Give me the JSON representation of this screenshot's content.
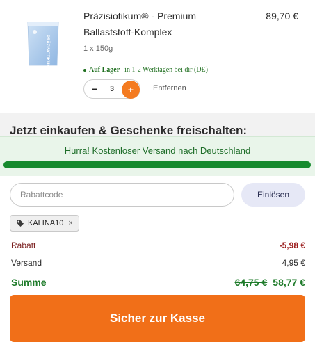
{
  "product": {
    "name": "Präzisiotikum® - Premium Ballaststoff-Komplex",
    "price": "89,70 €",
    "variant": "1 x 150g",
    "stock_status": "Auf Lager",
    "stock_detail": "| in 1-2 Werktagen bei dir (DE)",
    "quantity": "3",
    "minus_label": "−",
    "plus_label": "+",
    "remove_label": "Entfernen",
    "package_label": "PRÄZISIOTIKUM"
  },
  "promo": {
    "heading": "Jetzt einkaufen & Geschenke freischalten:",
    "shipping_message": "Hurra! Kostenloser Versand nach Deutschland",
    "progress_fraction": 1.0
  },
  "coupon": {
    "placeholder": "Rabattcode",
    "value": "",
    "redeem_label": "Einlösen",
    "applied_code": "KALINA10",
    "remove_glyph": "×"
  },
  "summary": {
    "discount_label": "Rabatt",
    "discount_value": "-5,98 €",
    "shipping_label": "Versand",
    "shipping_value": "4,95 €",
    "total_label": "Summe",
    "total_original": "64,75 €",
    "total_value": "58,77 €"
  },
  "checkout": {
    "label": "Sicher zur Kasse"
  },
  "colors": {
    "accent": "#f16f18",
    "success": "#1e7b2a",
    "progress": "#168a2e",
    "discount": "#9b1c1c"
  }
}
